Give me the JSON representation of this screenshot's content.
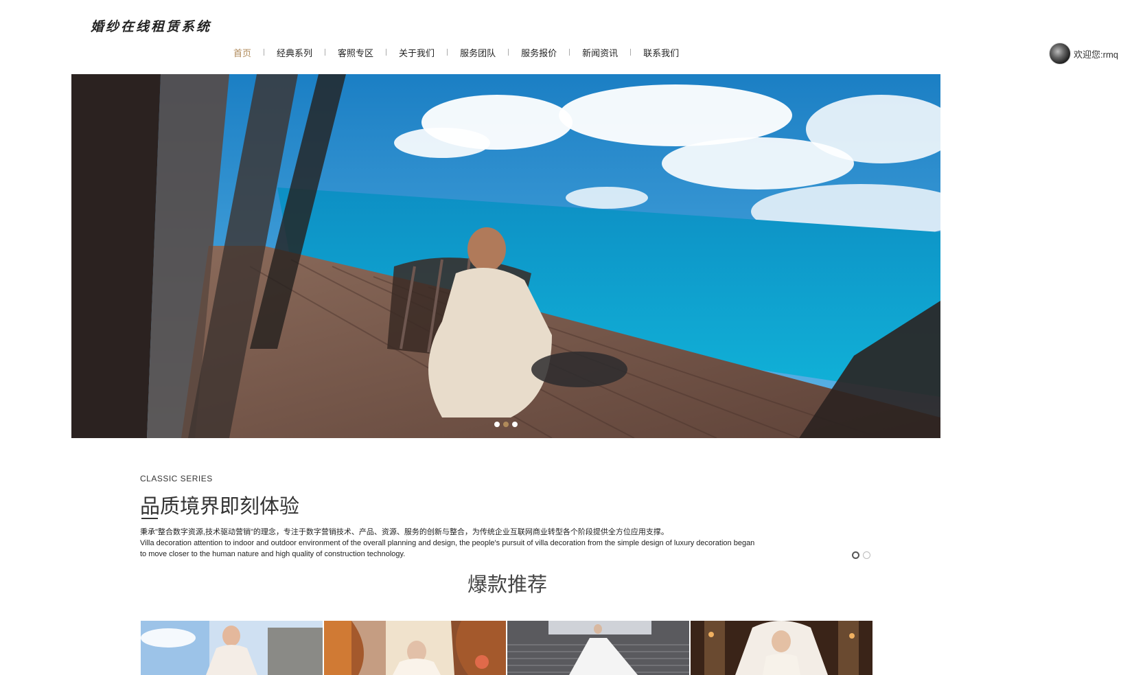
{
  "header": {
    "logo": "婚纱在线租赁系统",
    "nav": [
      {
        "label": "首页",
        "active": true
      },
      {
        "label": "经典系列",
        "active": false
      },
      {
        "label": "客照专区",
        "active": false
      },
      {
        "label": "关于我们",
        "active": false
      },
      {
        "label": "服务团队",
        "active": false
      },
      {
        "label": "服务报价",
        "active": false
      },
      {
        "label": "新闻资讯",
        "active": false
      },
      {
        "label": "联系我们",
        "active": false
      }
    ],
    "user_greeting": "欢迎您:rmq"
  },
  "banner": {
    "slide_count": 3,
    "active_slide": 2
  },
  "classic": {
    "subtitle": "CLASSIC SERIES",
    "title": "品质境界即刻体验",
    "desc_cn": "秉承\"整合数字资源,技术驱动营销\"的理念，专注于数字营销技术、产品、资源、服务的创新与整合，为传统企业互联网商业转型各个阶段提供全方位应用支撑。",
    "desc_en": "Villa decoration attention to indoor and outdoor environment of the overall planning and design, the people's pursuit of villa decoration from the simple design of luxury decoration began to move closer to the human nature and high quality of construction technology.",
    "pager_count": 2,
    "pager_active": 1
  },
  "hot": {
    "title": "爆款推荐",
    "products": 4
  },
  "colors": {
    "accent": "#b08a5a",
    "text": "#333333"
  }
}
